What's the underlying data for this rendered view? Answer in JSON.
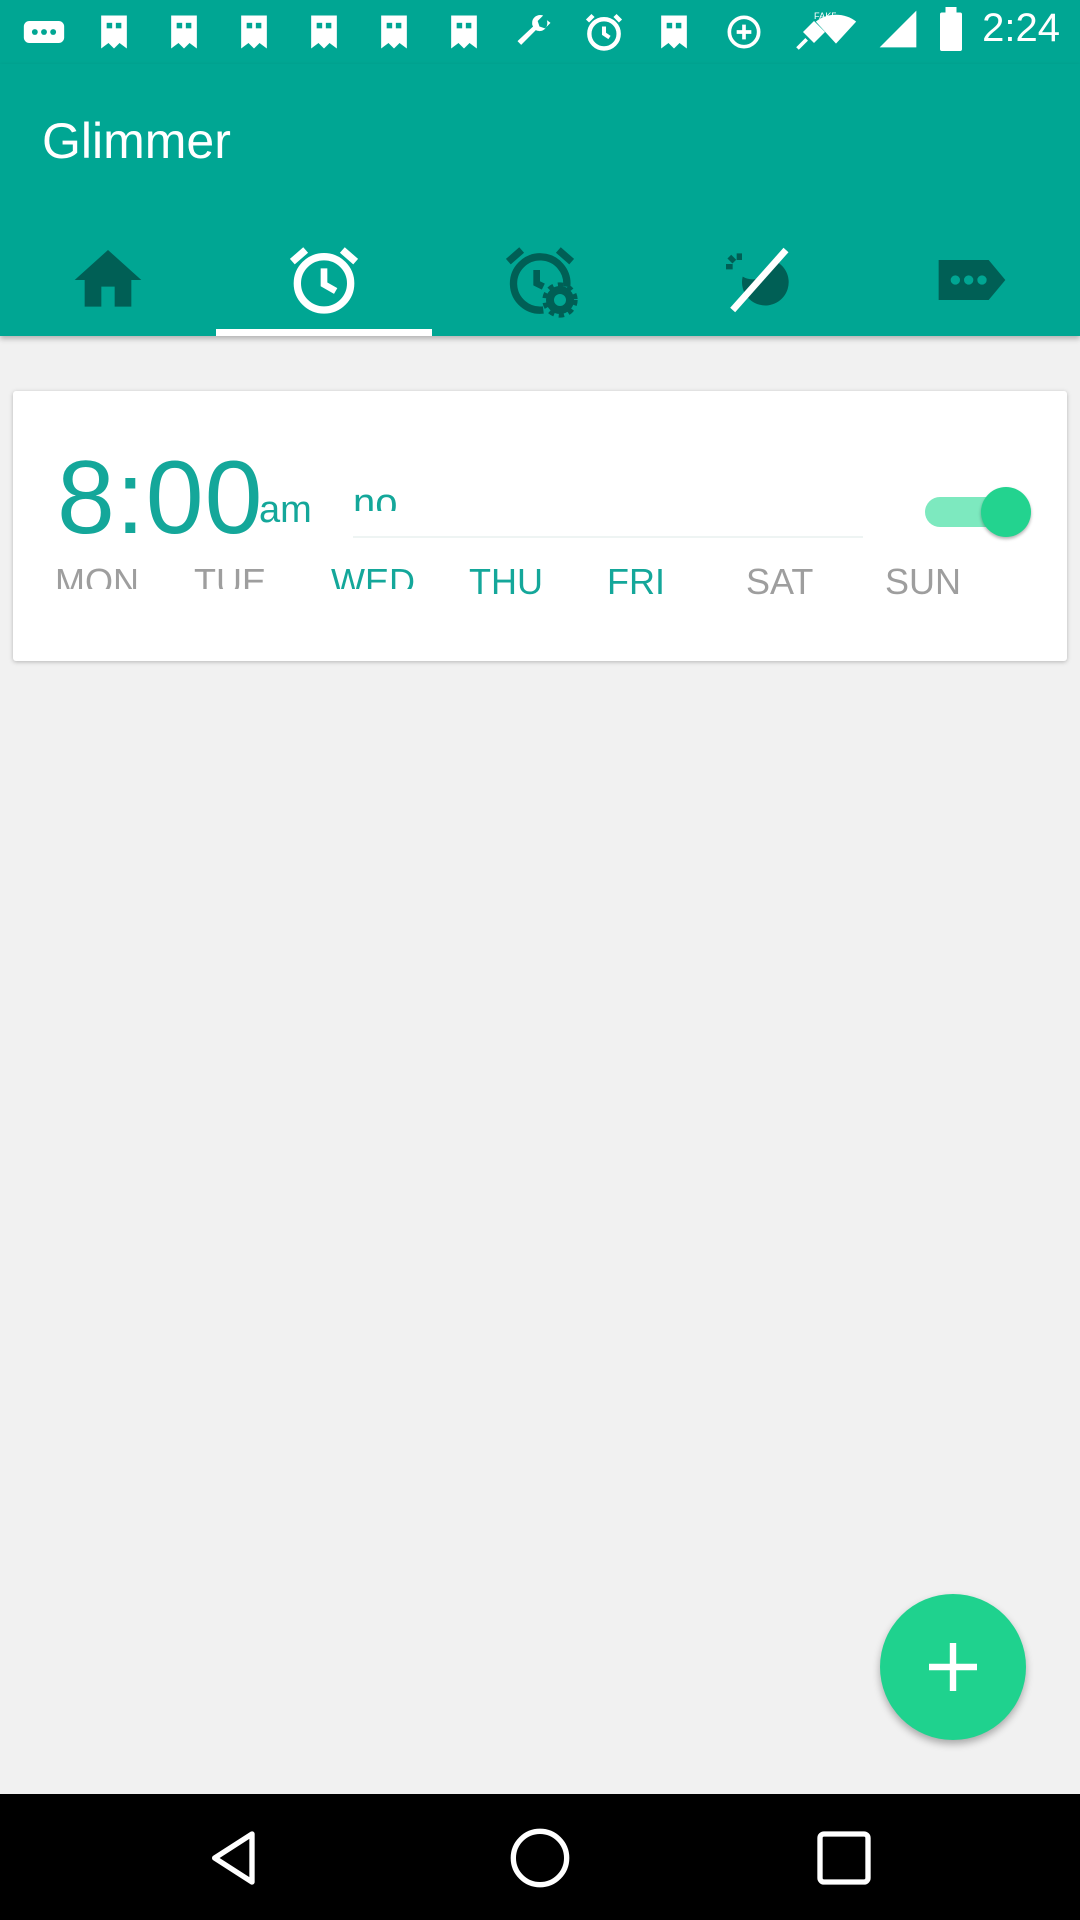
{
  "status_bar": {
    "time": "2:24",
    "icons": [
      "more-icon",
      "image-icon",
      "image-icon",
      "image-icon",
      "image-icon",
      "image-icon",
      "image-icon",
      "wrench-icon",
      "alarm-icon",
      "image-icon",
      "data-saver-icon",
      "fake-gps-icon",
      "wifi-icon",
      "signal-icon",
      "battery-icon"
    ]
  },
  "app_bar": {
    "title": "Glimmer",
    "tabs": [
      {
        "name": "home",
        "icon": "home-icon"
      },
      {
        "name": "alarms",
        "icon": "alarm-clock-icon",
        "active": true
      },
      {
        "name": "alarm-settings",
        "icon": "alarm-settings-icon"
      },
      {
        "name": "brightness",
        "icon": "brightness-icon"
      },
      {
        "name": "more",
        "icon": "label-icon"
      }
    ]
  },
  "alarm": {
    "time": "8:00",
    "period": "am",
    "label": "no",
    "enabled": true,
    "days": [
      {
        "label": "MON",
        "active": false
      },
      {
        "label": "TUE",
        "active": false
      },
      {
        "label": "WED",
        "active": true
      },
      {
        "label": "THU",
        "active": true
      },
      {
        "label": "FRI",
        "active": true
      },
      {
        "label": "SAT",
        "active": false
      },
      {
        "label": "SUN",
        "active": false
      }
    ]
  },
  "fab": {
    "icon": "add-icon"
  },
  "nav_bar": {
    "icons": [
      "back-icon",
      "home-circle-icon",
      "recents-icon"
    ]
  },
  "colors": {
    "primary": "#00a693",
    "accent": "#1fd28e",
    "day_on": "#14a79a",
    "day_off": "#9e9e9e"
  }
}
